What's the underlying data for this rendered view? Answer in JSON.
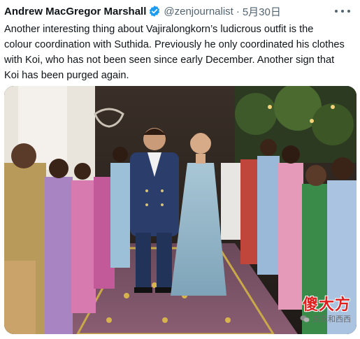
{
  "tweet": {
    "author_name": "Andrew MacGregor Marshall",
    "handle": "@zenjournalist",
    "separator": "·",
    "date": "5月30日",
    "verified_icon": "verified-badge-icon",
    "more_icon": "more-options-icon",
    "text_lines": [
      "Another interesting thing about Vajiralongkorn’s ludicrous outfit is the",
      "colour coordination with Suthida. Previously he only coordinated his clothes",
      "with Koi, who has not been seen since early December. Another sign that",
      "Koi has been purged again."
    ]
  },
  "watermark": {
    "main": "傻大方",
    "sub": "东东和西西",
    "icon": "wechat-icon"
  },
  "colors": {
    "handle": "#536471",
    "verified": "#1d9bf0",
    "watermark_red": "#e02020"
  }
}
